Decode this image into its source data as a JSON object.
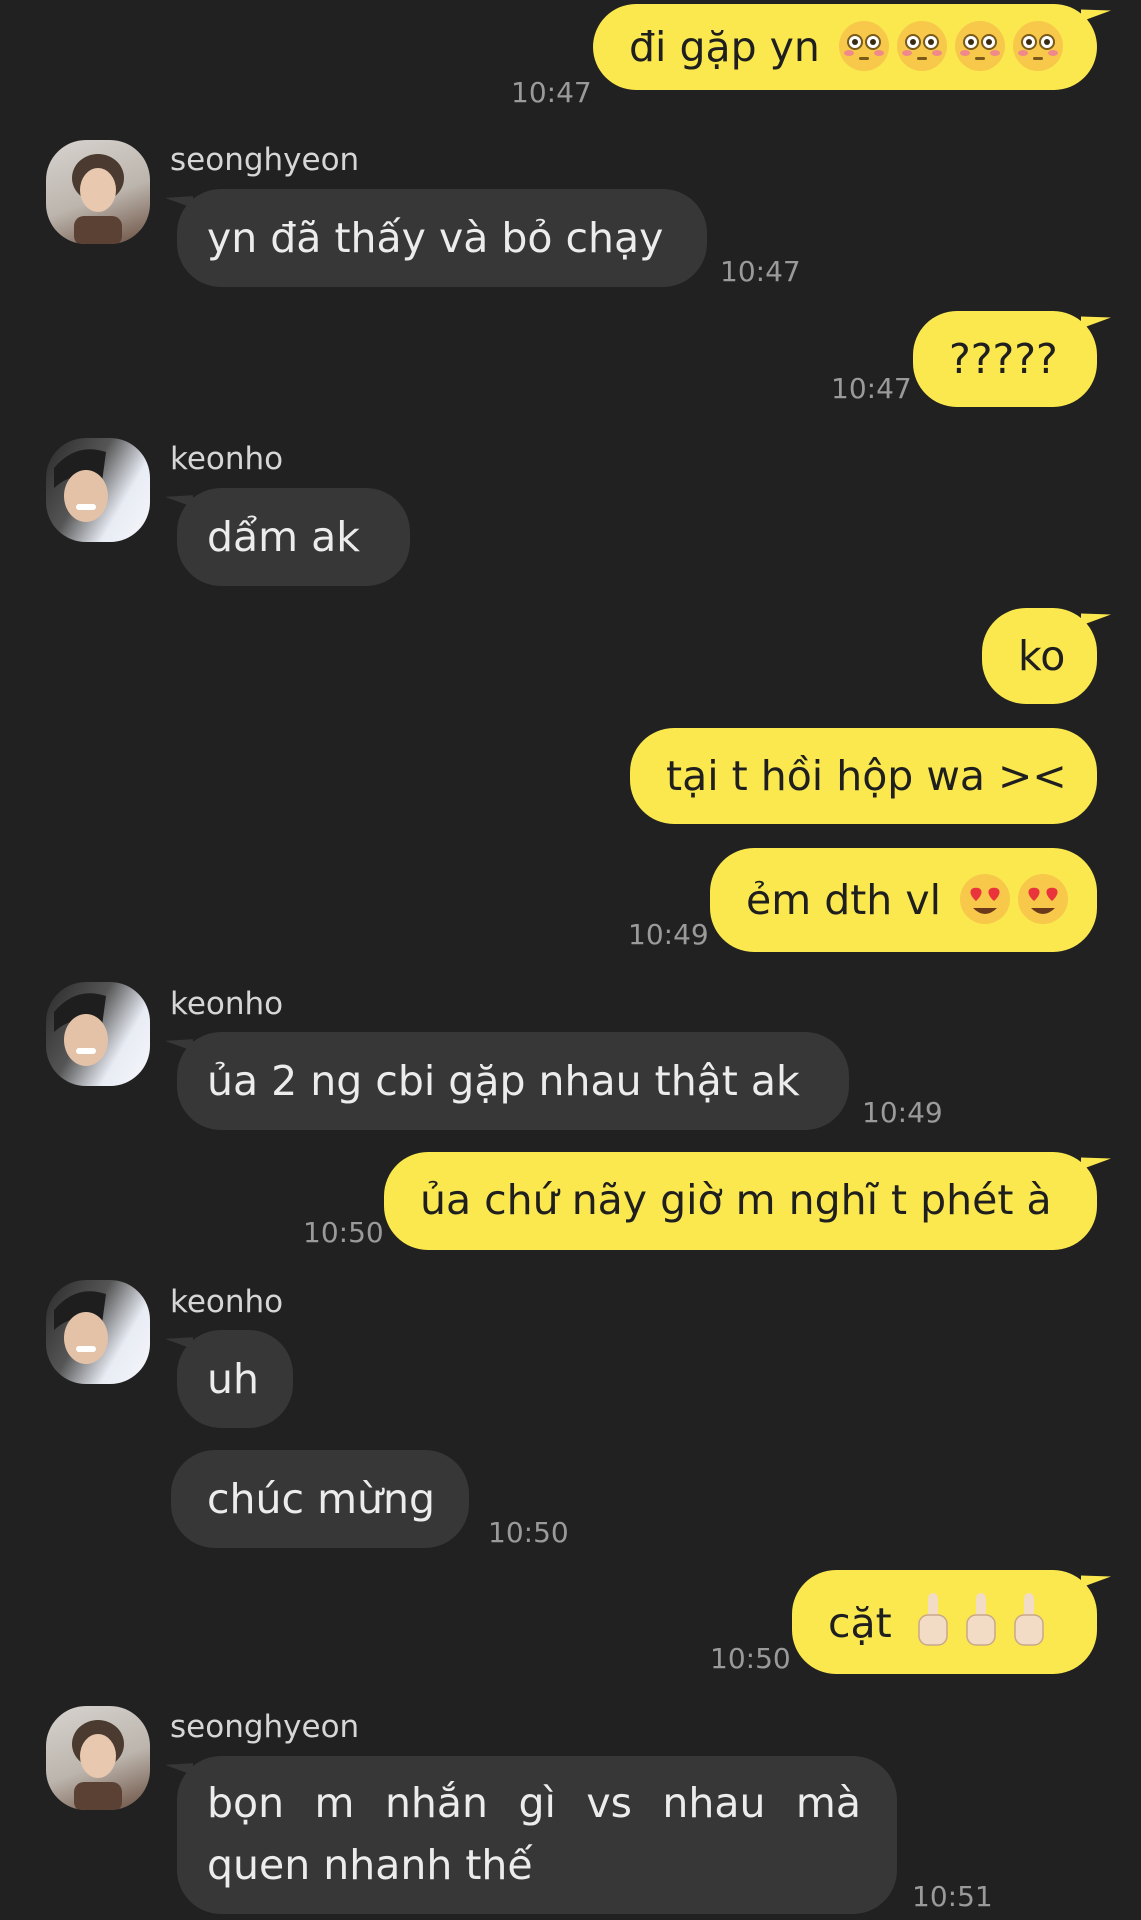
{
  "messages": [
    {
      "side": "out",
      "text": "đi gặp yn",
      "emoji": "flushed-face",
      "emoji_count": 4,
      "time": "10:47"
    },
    {
      "side": "in",
      "sender": "seonghyeon",
      "text": "yn đã thấy và bỏ chạy",
      "time": "10:47"
    },
    {
      "side": "out",
      "text": "?????",
      "time": "10:47"
    },
    {
      "side": "in",
      "sender": "keonho",
      "text": "dẩm ak"
    },
    {
      "side": "out",
      "text": "ko"
    },
    {
      "side": "out",
      "text": "tại t hồi hộp wa ><"
    },
    {
      "side": "out",
      "text": "ẻm dth vl",
      "emoji": "heart-eyes-face",
      "emoji_count": 2,
      "time": "10:49"
    },
    {
      "side": "in",
      "sender": "keonho",
      "text": "ủa 2 ng cbi gặp nhau thật ak",
      "time": "10:49"
    },
    {
      "side": "out",
      "text": "ủa chứ nãy giờ m nghĩ t phét à",
      "time": "10:50"
    },
    {
      "side": "in",
      "sender": "keonho",
      "text": "uh"
    },
    {
      "side": "in",
      "text": "chúc mừng",
      "time": "10:50"
    },
    {
      "side": "out",
      "text": "cặt",
      "emoji": "middle-finger",
      "emoji_count": 3,
      "time": "10:50"
    },
    {
      "side": "in",
      "sender": "seonghyeon",
      "text_line1": [
        "bọn",
        "m",
        "nhắn",
        "gì",
        "vs",
        "nhau",
        "mà"
      ],
      "text_line2": "quen nhanh thế",
      "time": "10:51"
    }
  ],
  "colors": {
    "background": "#212121",
    "incoming_bubble": "#373737",
    "outgoing_bubble": "#fae84e",
    "incoming_text": "#ececec",
    "outgoing_text": "#1f1f1f",
    "timestamp": "#9a9a9a"
  }
}
